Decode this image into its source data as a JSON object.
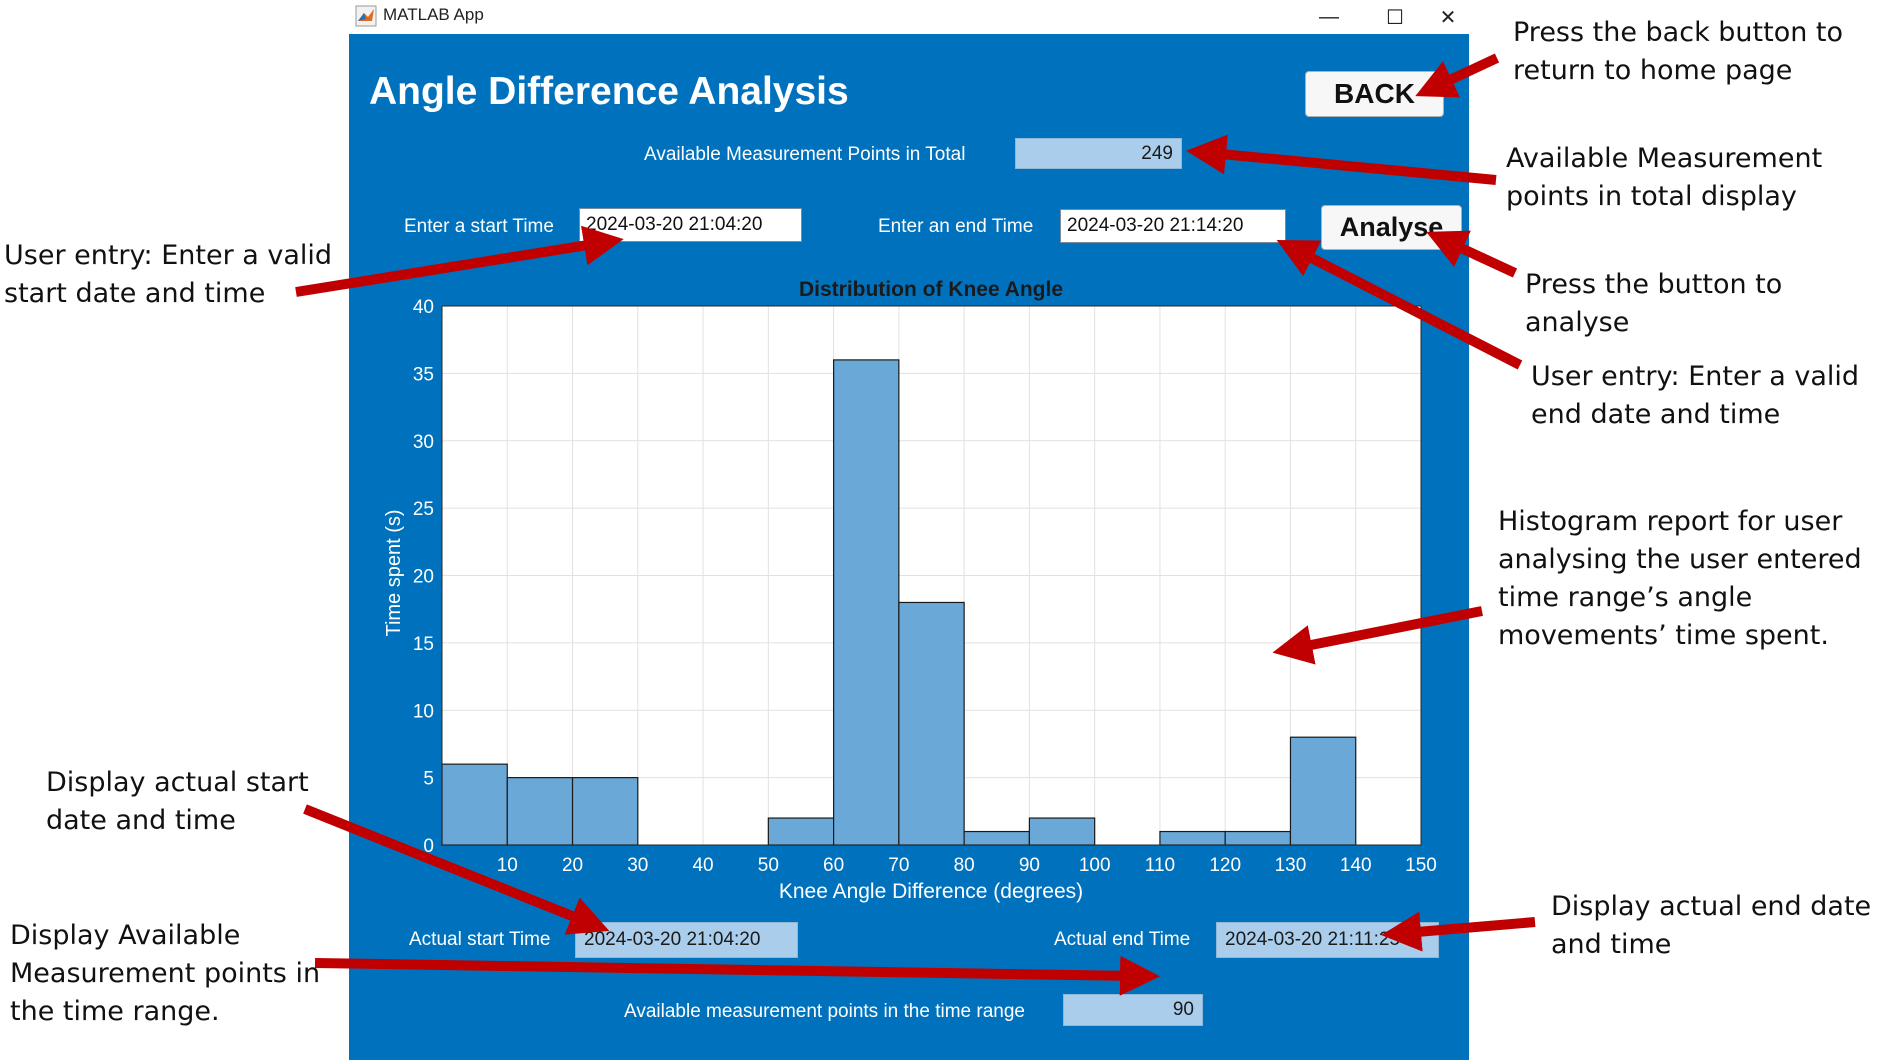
{
  "window": {
    "title": "MATLAB App",
    "minimize": "—",
    "maximize": "☐",
    "close": "✕"
  },
  "page": {
    "title": "Angle Difference Analysis",
    "back_label": "BACK",
    "analyse_label": "Analyse"
  },
  "total_points": {
    "label": "Available Measurement Points in Total",
    "value": "249"
  },
  "inputs": {
    "start_label": "Enter a start Time",
    "start_value": "2024-03-20 21:04:20",
    "end_label": "Enter an end Time",
    "end_value": "2024-03-20 21:14:20"
  },
  "actual": {
    "start_label": "Actual start Time",
    "start_value": "2024-03-20 21:04:20",
    "end_label": "Actual end Time",
    "end_value": "2024-03-20 21:11:25"
  },
  "range_points": {
    "label": "Available measurement points in the time range",
    "value": "90"
  },
  "chart_data": {
    "type": "bar",
    "title": "Distribution of Knee Angle",
    "xlabel": "Knee Angle Difference (degrees)",
    "ylabel": "Time spent (s)",
    "xlim": [
      0,
      150
    ],
    "ylim": [
      0,
      40
    ],
    "x_ticks": [
      "10",
      "20",
      "30",
      "40",
      "50",
      "60",
      "70",
      "80",
      "90",
      "100",
      "110",
      "120",
      "130",
      "140",
      "150"
    ],
    "y_ticks": [
      "0",
      "5",
      "10",
      "15",
      "20",
      "25",
      "30",
      "35",
      "40"
    ],
    "bins": [
      {
        "x0": 0,
        "x1": 10,
        "value": 6
      },
      {
        "x0": 10,
        "x1": 20,
        "value": 5
      },
      {
        "x0": 20,
        "x1": 30,
        "value": 5
      },
      {
        "x0": 50,
        "x1": 60,
        "value": 2
      },
      {
        "x0": 60,
        "x1": 70,
        "value": 36
      },
      {
        "x0": 70,
        "x1": 80,
        "value": 18
      },
      {
        "x0": 80,
        "x1": 90,
        "value": 1
      },
      {
        "x0": 90,
        "x1": 100,
        "value": 2
      },
      {
        "x0": 110,
        "x1": 120,
        "value": 1
      },
      {
        "x0": 120,
        "x1": 130,
        "value": 1
      },
      {
        "x0": 130,
        "x1": 140,
        "value": 8
      }
    ],
    "grid": true,
    "bar_color": "#6aa8d8"
  },
  "annotations": {
    "back": "Press the back button to\nreturn to home page",
    "total": "Available Measurement\npoints in total display",
    "analyse": "Press the button to analyse",
    "start": "User entry: Enter a valid\nstart date and time",
    "end": "User entry: Enter a valid\nend date and time",
    "histogram": "Histogram report for user\nanalysing the user entered\ntime range’s angle\nmovements’ time spent.",
    "actual_start": "Display actual start\ndate and time",
    "actual_end": "Display actual end date\nand time",
    "range_points": "Display Available\nMeasurement points in\nthe time range."
  },
  "colors": {
    "panel": "#0072bd",
    "arrow": "#c00000"
  }
}
